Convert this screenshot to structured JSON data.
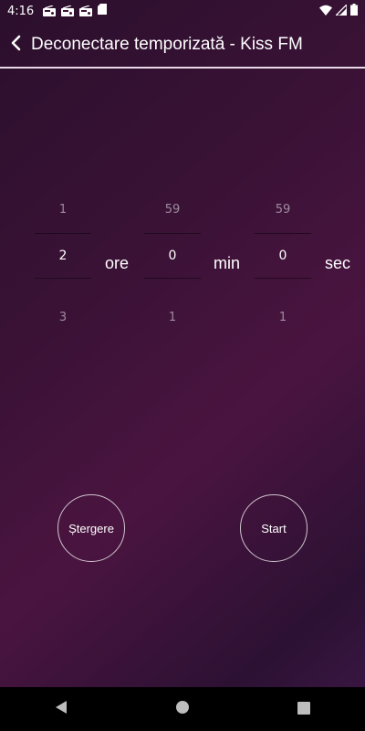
{
  "status_bar": {
    "time": "4:16",
    "left_icons": [
      "radio-icon",
      "radio-icon",
      "radio-icon",
      "sd-card-icon"
    ],
    "right_icons": [
      "wifi-icon",
      "signal-icon",
      "battery-icon"
    ]
  },
  "app_bar": {
    "title": "Deconectare temporizată - Kiss FM",
    "back_icon": "chevron-left-icon"
  },
  "timer": {
    "hours": {
      "prev": "1",
      "current": "2",
      "next": "3",
      "unit": "ore"
    },
    "minutes": {
      "prev": "59",
      "current": "0",
      "next": "1",
      "unit": "min"
    },
    "seconds": {
      "prev": "59",
      "current": "0",
      "next": "1",
      "unit": "sec"
    }
  },
  "actions": {
    "clear_label": "Ștergere",
    "start_label": "Start"
  },
  "nav_bar": {
    "icons": [
      "back-triangle-icon",
      "home-circle-icon",
      "recents-square-icon"
    ]
  },
  "colors": {
    "background_start": "#2b0f2c",
    "background_mid": "#4a1440",
    "accent_line": "#e8d8e8"
  }
}
